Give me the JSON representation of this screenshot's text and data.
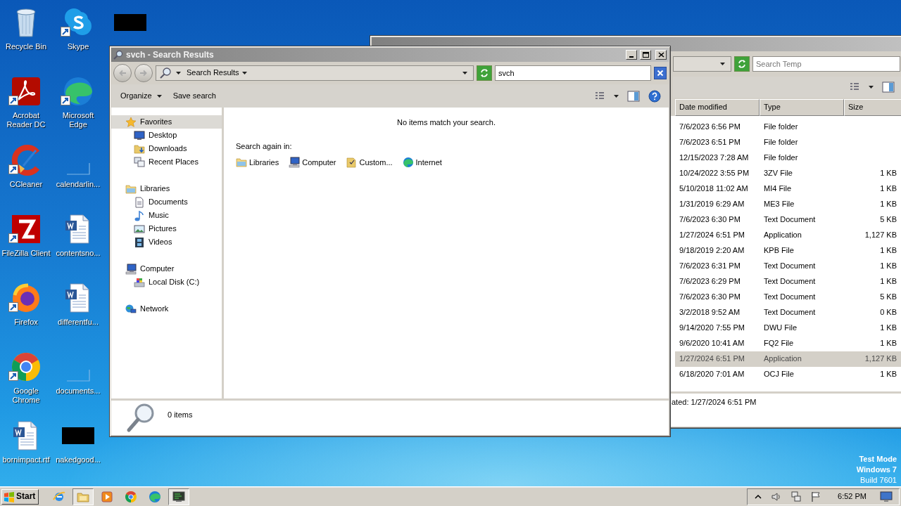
{
  "desktop_icons": [
    {
      "label": "Recycle Bin",
      "kind": "recycle",
      "shortcut": false
    },
    {
      "label": "Acrobat Reader DC",
      "kind": "acrobat",
      "shortcut": true
    },
    {
      "label": "CCleaner",
      "kind": "ccleaner",
      "shortcut": true
    },
    {
      "label": "FileZilla Client",
      "kind": "filezilla",
      "shortcut": true
    },
    {
      "label": "Firefox",
      "kind": "firefox",
      "shortcut": true
    },
    {
      "label": "Google Chrome",
      "kind": "chrome",
      "shortcut": true
    },
    {
      "label": "bornimpact.rtf",
      "kind": "word",
      "shortcut": false
    },
    {
      "label": "Skype",
      "kind": "skype",
      "shortcut": true
    },
    {
      "label": "Microsoft Edge",
      "kind": "edge",
      "shortcut": true
    },
    {
      "label": "calendarlin...",
      "kind": "blank",
      "shortcut": false
    },
    {
      "label": "contentsno...",
      "kind": "word",
      "shortcut": false
    },
    {
      "label": "differentfu...",
      "kind": "word",
      "shortcut": false
    },
    {
      "label": "documents...",
      "kind": "blank",
      "shortcut": false
    },
    {
      "label": "nakedgood...",
      "kind": "thumb",
      "shortcut": false
    },
    {
      "kind": "thumb",
      "shortcut": false
    }
  ],
  "temp_window": {
    "search_placeholder": "Search Temp",
    "columns": [
      "Date modified",
      "Type",
      "Size"
    ],
    "rows": [
      {
        "date": "7/6/2023 6:56 PM",
        "type": "File folder",
        "selected": false
      },
      {
        "date": "7/6/2023 6:51 PM",
        "type": "File folder",
        "selected": false
      },
      {
        "date": "12/15/2023 7:28 AM",
        "type": "File folder",
        "selected": false
      },
      {
        "date": "10/24/2022 3:55 PM",
        "type": "3ZV File",
        "size": "1 KB",
        "selected": false
      },
      {
        "date": "5/10/2018 11:02 AM",
        "type": "MI4 File",
        "size": "1 KB",
        "selected": false
      },
      {
        "date": "1/31/2019 6:29 AM",
        "type": "ME3 File",
        "size": "1 KB",
        "selected": false
      },
      {
        "date": "7/6/2023 6:30 PM",
        "type": "Text Document",
        "size": "5 KB",
        "selected": false
      },
      {
        "date": "1/27/2024 6:51 PM",
        "type": "Application",
        "size": "1,127 KB",
        "selected": false
      },
      {
        "date": "9/18/2019 2:20 AM",
        "type": "KPB File",
        "size": "1 KB",
        "selected": false
      },
      {
        "date": "7/6/2023 6:31 PM",
        "type": "Text Document",
        "size": "1 KB",
        "selected": false
      },
      {
        "date": "7/6/2023 6:29 PM",
        "type": "Text Document",
        "size": "1 KB",
        "selected": false
      },
      {
        "date": "7/6/2023 6:30 PM",
        "type": "Text Document",
        "size": "5 KB",
        "selected": false
      },
      {
        "date": "3/2/2018 9:52 AM",
        "type": "Text Document",
        "size": "0 KB",
        "selected": false
      },
      {
        "date": "9/14/2020 7:55 PM",
        "type": "DWU File",
        "size": "1 KB",
        "selected": false
      },
      {
        "date": "9/6/2020 10:41 AM",
        "type": "FQ2 File",
        "size": "1 KB",
        "selected": false
      },
      {
        "date": "1/27/2024 6:51 PM",
        "type": "Application",
        "size": "1,127 KB",
        "selected": true
      },
      {
        "date": "6/18/2020 7:01 AM",
        "type": "OCJ File",
        "size": "1 KB",
        "selected": false
      }
    ],
    "status": "ated: 1/27/2024 6:51 PM"
  },
  "search_window": {
    "title": "svch - Search Results",
    "breadcrumb": "Search Results",
    "search_value": "svch",
    "toolbar": [
      {
        "label": "Organize",
        "menu": true
      },
      {
        "label": "Save search",
        "menu": false
      }
    ],
    "nav": [
      {
        "label": "Favorites",
        "kind": "star",
        "selected": true,
        "children": [
          {
            "label": "Desktop",
            "kind": "desktop",
            "selected": false
          },
          {
            "label": "Downloads",
            "kind": "downloads",
            "selected": false
          },
          {
            "label": "Recent Places",
            "kind": "recent",
            "selected": false
          }
        ]
      },
      {
        "label": "Libraries",
        "kind": "library",
        "selected": false,
        "children": [
          {
            "label": "Documents",
            "kind": "documents",
            "selected": false
          },
          {
            "label": "Music",
            "kind": "music",
            "selected": false
          },
          {
            "label": "Pictures",
            "kind": "pictures",
            "selected": false
          },
          {
            "label": "Videos",
            "kind": "videos",
            "selected": false
          }
        ]
      },
      {
        "label": "Computer",
        "kind": "computer",
        "selected": false,
        "children": [
          {
            "label": "Local Disk (C:)",
            "kind": "disk",
            "selected": false
          }
        ]
      },
      {
        "label": "Network",
        "kind": "network",
        "selected": false
      }
    ],
    "message": "No items match your search.",
    "search_again_label": "Search again in:",
    "search_again": [
      {
        "label": "Libraries",
        "kind": "library"
      },
      {
        "label": "Computer",
        "kind": "computer"
      },
      {
        "label": "Custom...",
        "kind": "custom"
      },
      {
        "label": "Internet",
        "kind": "internet"
      }
    ],
    "item_count": "0 items"
  },
  "taskbar": {
    "start": "Start",
    "apps": [
      {
        "kind": "ie",
        "active": false
      },
      {
        "kind": "explorer",
        "active": true
      },
      {
        "kind": "media",
        "active": false
      },
      {
        "kind": "chrome",
        "active": false
      },
      {
        "kind": "edge",
        "active": false
      },
      {
        "kind": "terminal",
        "active": true
      }
    ],
    "clock": "6:52 PM"
  },
  "desktop_notice": [
    "Test Mode",
    "Windows 7",
    "Build 7601"
  ]
}
